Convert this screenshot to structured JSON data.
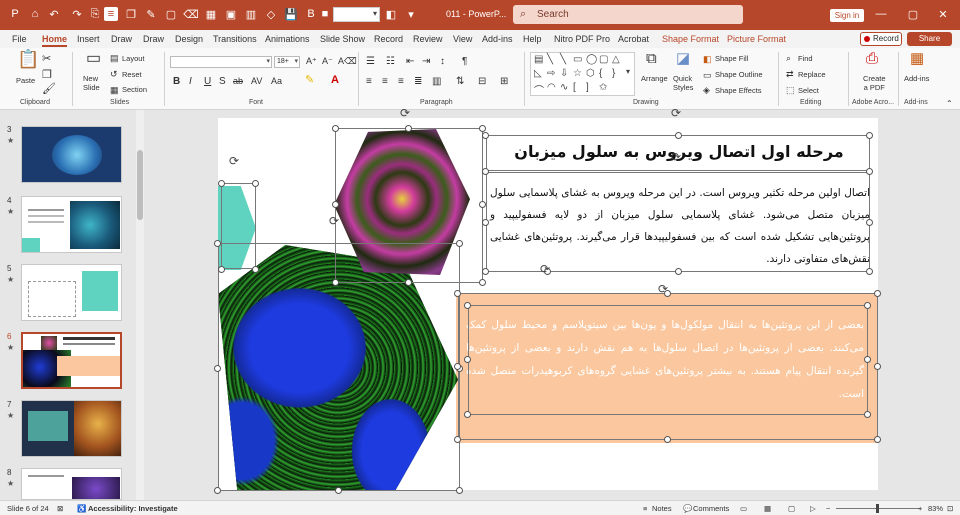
{
  "title_bar": {
    "document_name": "011 - PowerP...",
    "search_placeholder": "Search",
    "sign_in": "Sign in"
  },
  "tabs": [
    "File",
    "Home",
    "Insert",
    "Draw",
    "Draw",
    "Design",
    "Transitions",
    "Animations",
    "Slide Show",
    "Record",
    "Review",
    "View",
    "Add-ins",
    "Help",
    "Nitro PDF Pro",
    "Acrobat",
    "Shape Format",
    "Picture Format"
  ],
  "record_label": "Record",
  "share_label": "Share",
  "ribbon": {
    "groups": [
      "Clipboard",
      "Slides",
      "Font",
      "Paragraph",
      "Drawing",
      "Editing",
      "Adobe Acro...",
      "Add-ins"
    ],
    "paste": "Paste",
    "new_slide": "New\nSlide",
    "layout": "Layout",
    "reset": "Reset",
    "section": "Section",
    "font_size": "18+",
    "arrange": "Arrange",
    "quick_styles": "Quick\nStyles",
    "shape_fill": "Shape Fill",
    "shape_outline": "Shape Outline",
    "shape_effects": "Shape Effects",
    "find": "Find",
    "replace": "Replace",
    "select": "Select",
    "create_pdf": "Create\na PDF",
    "add_ins": "Add-ins"
  },
  "thumbnails": [
    {
      "num": "3",
      "starred": true,
      "selected": false
    },
    {
      "num": "4",
      "starred": true,
      "selected": false
    },
    {
      "num": "5",
      "starred": true,
      "selected": false
    },
    {
      "num": "6",
      "starred": true,
      "selected": true
    },
    {
      "num": "7",
      "starred": true,
      "selected": false
    },
    {
      "num": "8",
      "starred": true,
      "selected": false
    }
  ],
  "slide": {
    "title": "مرحله اول اتصال ویروس به سلول میزبان",
    "paragraph1": "اتصال اولین مرحله تکثیر ویروس است. در این مرحله ویروس به غشای پلاسمایی سلول میزبان متصل می‌شود. غشای پلاسمایی سلول میزبان از دو لایه فسفولیپید و پروتئین‌هایی تشکیل شده است که بین فسفولیپیدها قرار می‌گیرند. پروتئین‌های غشایی نقش‌های متفاوتی دارند.",
    "paragraph2": "بعضی از این پروتئین‌ها به انتقال مولکول‌ها و یون‌ها بین سیتوپلاسم و محیط سلول کمک می‌کنند. بعضی از پروتئین‌ها در اتصال سلول‌ها به هم نقش دارند و بعضی از پروتئین‌ها گیرنده انتقال پیام هستند. به بیشتر پروتئین‌های غشایی گروه‌های کربوهیدرات متصل شده است.",
    "accent_color": "#fbc79e",
    "teal_color": "#5fd3bf"
  },
  "status": {
    "slide_of": "Slide 6 of 24",
    "accessibility": "Accessibility: Investigate",
    "notes": "Notes",
    "comments": "Comments",
    "zoom": "83%"
  }
}
